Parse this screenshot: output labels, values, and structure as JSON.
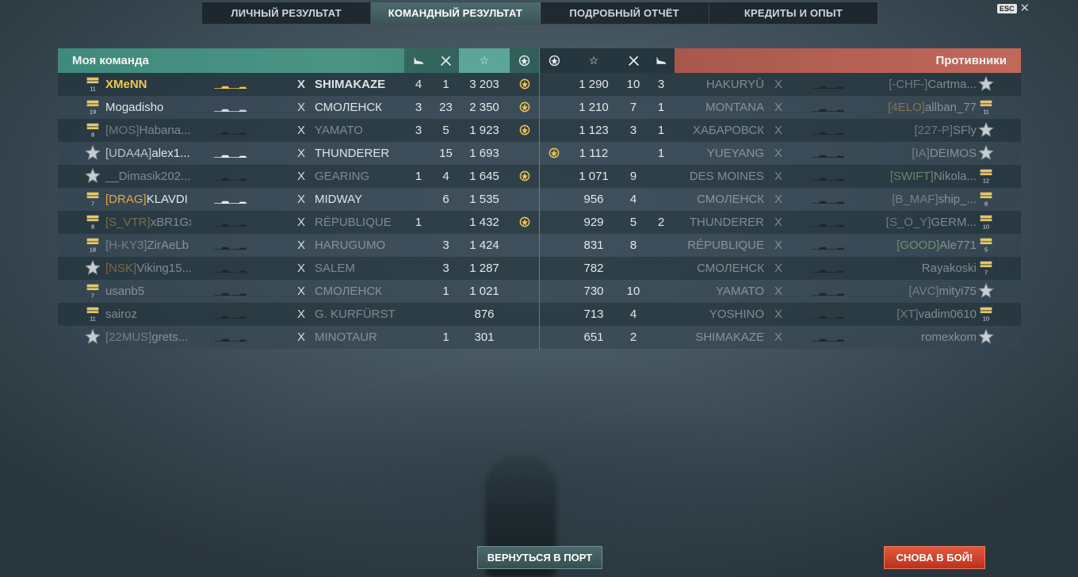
{
  "tabs": [
    {
      "label": "ЛИЧНЫЙ РЕЗУЛЬТАТ",
      "active": false
    },
    {
      "label": "КОМАНДНЫЙ РЕЗУЛЬТАТ",
      "active": true
    },
    {
      "label": "ПОДРОБНЫЙ ОТЧЁТ",
      "active": false
    },
    {
      "label": "КРЕДИТЫ И ОПЫТ",
      "active": false
    }
  ],
  "esc_label": "ESC",
  "my_team": {
    "title": "Моя команда",
    "columns": [
      "planes-icon",
      "kills-icon",
      "star-icon",
      "ribbon-icon"
    ],
    "rows": [
      {
        "rank": "11",
        "clan": "",
        "name": "XMeNN",
        "self": true,
        "x": "X",
        "ship": "SHIMAKAZE",
        "planes": "4",
        "kills": "1",
        "xp": "3 203",
        "medal": true,
        "dim": false
      },
      {
        "rank": "19",
        "clan": "",
        "name": "Mogadisho",
        "self": false,
        "x": "X",
        "ship": "СМОЛЕНСК",
        "planes": "3",
        "kills": "23",
        "xp": "2 350",
        "medal": true,
        "dim": false
      },
      {
        "rank": "8",
        "clan": "[MOS]",
        "name": "Habana...",
        "self": false,
        "x": "X",
        "ship": "YAMATO",
        "planes": "3",
        "kills": "5",
        "xp": "1 923",
        "medal": true,
        "dim": true
      },
      {
        "rank": "",
        "clan": "[UDA4A]",
        "name": "alex1...",
        "self": false,
        "x": "X",
        "ship": "THUNDERER",
        "planes": "",
        "kills": "15",
        "xp": "1 693",
        "medal": false,
        "dim": false
      },
      {
        "rank": "",
        "clan": "",
        "name": "__Dimasik202...",
        "self": false,
        "x": "X",
        "ship": "GEARING",
        "planes": "1",
        "kills": "4",
        "xp": "1 645",
        "medal": true,
        "dim": true
      },
      {
        "rank": "7",
        "clan": "[DRAG]",
        "name": "KLAVDI",
        "self": false,
        "x": "X",
        "ship": "MIDWAY",
        "planes": "",
        "kills": "6",
        "xp": "1 535",
        "medal": false,
        "dim": false
      },
      {
        "rank": "8",
        "clan": "[S_VTR]",
        "name": "xBR1Gx",
        "self": false,
        "x": "X",
        "ship": "RÉPUBLIQUE",
        "planes": "1",
        "kills": "",
        "xp": "1 432",
        "medal": true,
        "dim": true
      },
      {
        "rank": "18",
        "clan": "[H-KY3]",
        "name": "ZirAeLb",
        "self": false,
        "x": "X",
        "ship": "HARUGUMO",
        "planes": "",
        "kills": "3",
        "xp": "1 424",
        "medal": false,
        "dim": true
      },
      {
        "rank": "",
        "clan": "[NSK]",
        "name": "Viking15...",
        "self": false,
        "x": "X",
        "ship": "SALEM",
        "planes": "",
        "kills": "3",
        "xp": "1 287",
        "medal": false,
        "dim": true
      },
      {
        "rank": "7",
        "clan": "",
        "name": "usanb5",
        "self": false,
        "x": "X",
        "ship": "СМОЛЕНСК",
        "planes": "",
        "kills": "1",
        "xp": "1 021",
        "medal": false,
        "dim": true
      },
      {
        "rank": "11",
        "clan": "",
        "name": "sairoz",
        "self": false,
        "x": "X",
        "ship": "G. KURFÜRST",
        "planes": "",
        "kills": "",
        "xp": "876",
        "medal": false,
        "dim": true
      },
      {
        "rank": "",
        "clan": "[22MUS]",
        "name": "grets...",
        "self": false,
        "x": "X",
        "ship": "MINOTAUR",
        "planes": "",
        "kills": "1",
        "xp": "301",
        "medal": false,
        "dim": true
      }
    ]
  },
  "enemy_team": {
    "title": "Противники",
    "columns": [
      "ribbon-icon",
      "star-icon",
      "kills-icon",
      "planes-icon"
    ],
    "rows": [
      {
        "medal": false,
        "xp": "1 290",
        "kills": "10",
        "planes": "3",
        "ship": "HAKURYŪ",
        "x": "X",
        "clan": "[-CHF-]",
        "name": "Cartma...",
        "rank": "",
        "dim": true
      },
      {
        "medal": false,
        "xp": "1 210",
        "kills": "7",
        "planes": "1",
        "ship": "MONTANA",
        "x": "X",
        "clan": "[4ELO]",
        "name": "allban_77",
        "rank": "11",
        "dim": true
      },
      {
        "medal": false,
        "xp": "1 123",
        "kills": "3",
        "planes": "1",
        "ship": "ХАБАРОВСК",
        "x": "X",
        "clan": "[227-P]",
        "name": "SFly",
        "rank": "",
        "dim": true
      },
      {
        "medal": true,
        "xp": "1 112",
        "kills": "",
        "planes": "1",
        "ship": "YUEYANG",
        "x": "X",
        "clan": "[IA]",
        "name": "DEIMOS",
        "rank": "",
        "dim": true
      },
      {
        "medal": false,
        "xp": "1 071",
        "kills": "9",
        "planes": "",
        "ship": "DES MOINES",
        "x": "X",
        "clan": "[SWIFT]",
        "name": "Nikola...",
        "rank": "12",
        "dim": true
      },
      {
        "medal": false,
        "xp": "956",
        "kills": "4",
        "planes": "",
        "ship": "СМОЛЕНСК",
        "x": "X",
        "clan": "[B_MAF]",
        "name": "ship_...",
        "rank": "8",
        "dim": true
      },
      {
        "medal": false,
        "xp": "929",
        "kills": "5",
        "planes": "2",
        "ship": "THUNDERER",
        "x": "X",
        "clan": "[S_O_Y]",
        "name": "GERM...",
        "rank": "10",
        "dim": true
      },
      {
        "medal": false,
        "xp": "831",
        "kills": "8",
        "planes": "",
        "ship": "RÉPUBLIQUE",
        "x": "X",
        "clan": "[GOOD]",
        "name": "Ale771",
        "rank": "5",
        "dim": true
      },
      {
        "medal": false,
        "xp": "782",
        "kills": "",
        "planes": "",
        "ship": "СМОЛЕНСК",
        "x": "X",
        "clan": "",
        "name": "Rayakoski",
        "rank": "7",
        "dim": true
      },
      {
        "medal": false,
        "xp": "730",
        "kills": "10",
        "planes": "",
        "ship": "YAMATO",
        "x": "X",
        "clan": "[AVC]",
        "name": "mityi75",
        "rank": "",
        "dim": true
      },
      {
        "medal": false,
        "xp": "713",
        "kills": "4",
        "planes": "",
        "ship": "YOSHINO",
        "x": "X",
        "clan": "[XT]",
        "name": "vadim0610",
        "rank": "10",
        "dim": true
      },
      {
        "medal": false,
        "xp": "651",
        "kills": "2",
        "planes": "",
        "ship": "SHIMAKAZE",
        "x": "X",
        "clan": "",
        "name": "romexkom",
        "rank": "",
        "dim": true
      }
    ]
  },
  "buttons": {
    "port": "ВЕРНУТЬСЯ В ПОРТ",
    "battle": "СНОВА В БОЙ!"
  },
  "colors": {
    "my_header": "#4a9584",
    "enemy_header": "#c2685a",
    "self_name": "#f2c94c",
    "clan_orange": "#e0a84e",
    "clan_green": "#b5e08a",
    "battle_button": "#d9462b"
  }
}
